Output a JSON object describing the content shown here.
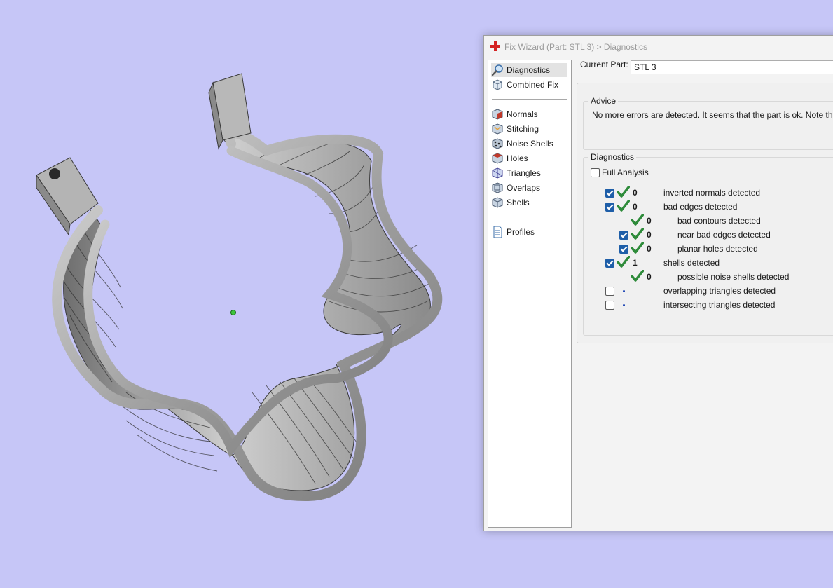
{
  "window": {
    "title": "Fix Wizard (Part: STL 3) > Diagnostics",
    "title_icon": "red-cross-icon"
  },
  "nav": {
    "items": [
      {
        "label": "Diagnostics",
        "icon": "magnifier-icon",
        "selected": true
      },
      {
        "label": "Combined Fix",
        "icon": "combined-fix-icon"
      },
      {
        "label": "Normals",
        "icon": "normals-cube-icon"
      },
      {
        "label": "Stitching",
        "icon": "stitching-cube-icon"
      },
      {
        "label": "Noise Shells",
        "icon": "noise-shells-cube-icon"
      },
      {
        "label": "Holes",
        "icon": "holes-cube-icon"
      },
      {
        "label": "Triangles",
        "icon": "triangles-cube-icon"
      },
      {
        "label": "Overlaps",
        "icon": "overlaps-cube-icon"
      },
      {
        "label": "Shells",
        "icon": "shells-cube-icon"
      },
      {
        "label": "Profiles",
        "icon": "document-icon"
      }
    ]
  },
  "part": {
    "label": "Current Part:",
    "value": "STL 3"
  },
  "advice": {
    "title": "Advice",
    "text": "No more errors are detected. It seems that the part is ok. Note that no"
  },
  "diagnostics": {
    "title": "Diagnostics",
    "full_analysis": {
      "label": "Full Analysis",
      "checked": false
    },
    "rows": [
      {
        "checked": true,
        "status": "ok",
        "count": "0",
        "label": "inverted normals detected"
      },
      {
        "checked": true,
        "status": "ok",
        "count": "0",
        "label": "bad edges detected"
      },
      {
        "checked": null,
        "status": "ok",
        "count": "0",
        "label": "bad contours detected"
      },
      {
        "checked": true,
        "status": "ok",
        "count": "0",
        "label": "near bad edges detected"
      },
      {
        "checked": true,
        "status": "ok",
        "count": "0",
        "label": "planar holes detected"
      },
      {
        "checked": true,
        "status": "ok",
        "count": "1",
        "label": "shells detected"
      },
      {
        "checked": null,
        "status": "ok",
        "count": "0",
        "label": "possible noise shells detected"
      },
      {
        "checked": false,
        "status": "pending",
        "count": "",
        "label": "overlapping triangles detected"
      },
      {
        "checked": false,
        "status": "pending",
        "count": "",
        "label": "intersecting triangles detected"
      }
    ]
  },
  "colors": {
    "viewport_background": "#c6c6f7",
    "checkbox_blue": "#1e5ea8",
    "tick_green": "#2e8b3a",
    "model_gray": "#a6a6a6"
  }
}
